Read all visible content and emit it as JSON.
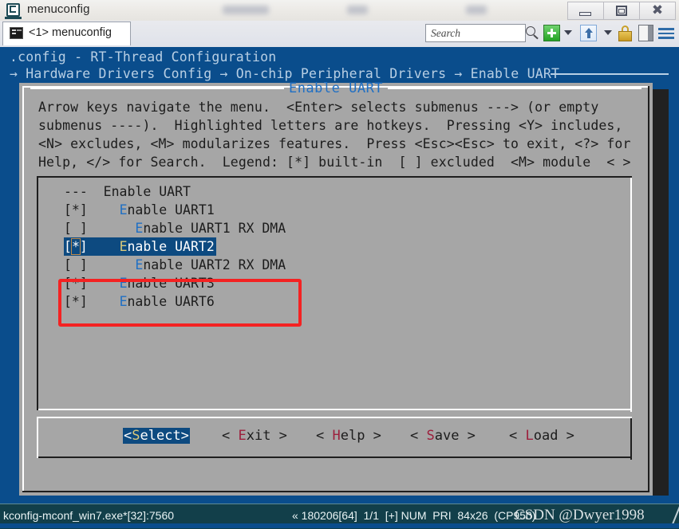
{
  "window": {
    "title": "menuconfig",
    "icon": "console-app-icon",
    "controls": {
      "minimize": "minimize-icon",
      "maximize": "maximize-icon",
      "close": "close-icon"
    }
  },
  "toolbar": {
    "tab_label": "<1> menuconfig",
    "tab_icon": "terminal-icon",
    "search_placeholder": "Search",
    "search_value": "",
    "search_icon": "search-icon",
    "new_tab_icon": "plus-icon",
    "new_tab_caret": "chevron-down-icon",
    "upload_icon": "up-arrow-icon",
    "upload_caret": "chevron-down-icon",
    "lock_icon": "lock-icon",
    "panel_icon": "split-panel-icon",
    "menu_icon": "hamburger-menu-icon"
  },
  "console": {
    "config_line": ".config - RT-Thread Configuration",
    "breadcrumb": "→ Hardware Drivers Config → On-chip Peripheral Drivers → Enable UART"
  },
  "dialog": {
    "title": "Enable UART",
    "help_lines": [
      "Arrow keys navigate the menu.  <Enter> selects submenus ---> (or empty",
      "submenus ----).  Highlighted letters are hotkeys.  Pressing <Y> includes,",
      "<N> excludes, <M> modularizes features.  Press <Esc><Esc> to exit, <?> for",
      "Help, </> for Search.  Legend: [*] built-in  [ ] excluded  <M> module  < >"
    ],
    "items": [
      {
        "marker": "---",
        "indent": 0,
        "hotkey": "",
        "rest": "Enable UART",
        "selected": false,
        "header": true
      },
      {
        "marker": "[*]",
        "indent": 0,
        "hotkey": "E",
        "rest": "nable UART1",
        "selected": false,
        "header": false
      },
      {
        "marker": "[ ]",
        "indent": 1,
        "hotkey": "E",
        "rest": "nable UART1 RX DMA",
        "selected": false,
        "header": false
      },
      {
        "marker": "[*]",
        "indent": 0,
        "hotkey": "E",
        "rest": "nable UART2",
        "selected": true,
        "header": false
      },
      {
        "marker": "[ ]",
        "indent": 1,
        "hotkey": "E",
        "rest": "nable UART2 RX DMA",
        "selected": false,
        "header": false
      },
      {
        "marker": "[*]",
        "indent": 0,
        "hotkey": "E",
        "rest": "nable UART3",
        "selected": false,
        "header": false
      },
      {
        "marker": "[*]",
        "indent": 0,
        "hotkey": "E",
        "rest": "nable UART6",
        "selected": false,
        "header": false
      }
    ],
    "buttons": [
      {
        "label": "<Select>",
        "hotkey": "S",
        "pre": "<",
        "post": "elect>",
        "active": true
      },
      {
        "label": "< Exit >",
        "hotkey": "E",
        "pre": "< ",
        "post": "xit >",
        "active": false
      },
      {
        "label": "< Help >",
        "hotkey": "H",
        "pre": "< ",
        "post": "elp >",
        "active": false
      },
      {
        "label": "< Save >",
        "hotkey": "S",
        "pre": "< ",
        "post": "ave >",
        "active": false
      },
      {
        "label": "< Load >",
        "hotkey": "L",
        "pre": "< ",
        "post": "oad >",
        "active": false
      }
    ]
  },
  "annotation": {
    "highlight_box_color": "#f42222",
    "highlight_target": "Enable UART2"
  },
  "statusbar": {
    "process": "kconfig-mconf_win7.exe*[32]:7560",
    "info": "« 180206[64]  1/1  [+] NUM  PRI  84x26  (CP950)",
    "watermark": "CSDN @Dwyer1998"
  },
  "colors": {
    "desktop_blue": "#0a4d8c",
    "dialog_gray": "#a6a6a6",
    "selection_blue": "#0d4a80",
    "hotkey_blue": "#1f6fc4",
    "hotkey_red": "#9d1f3c",
    "statusbar": "#123f4a"
  }
}
